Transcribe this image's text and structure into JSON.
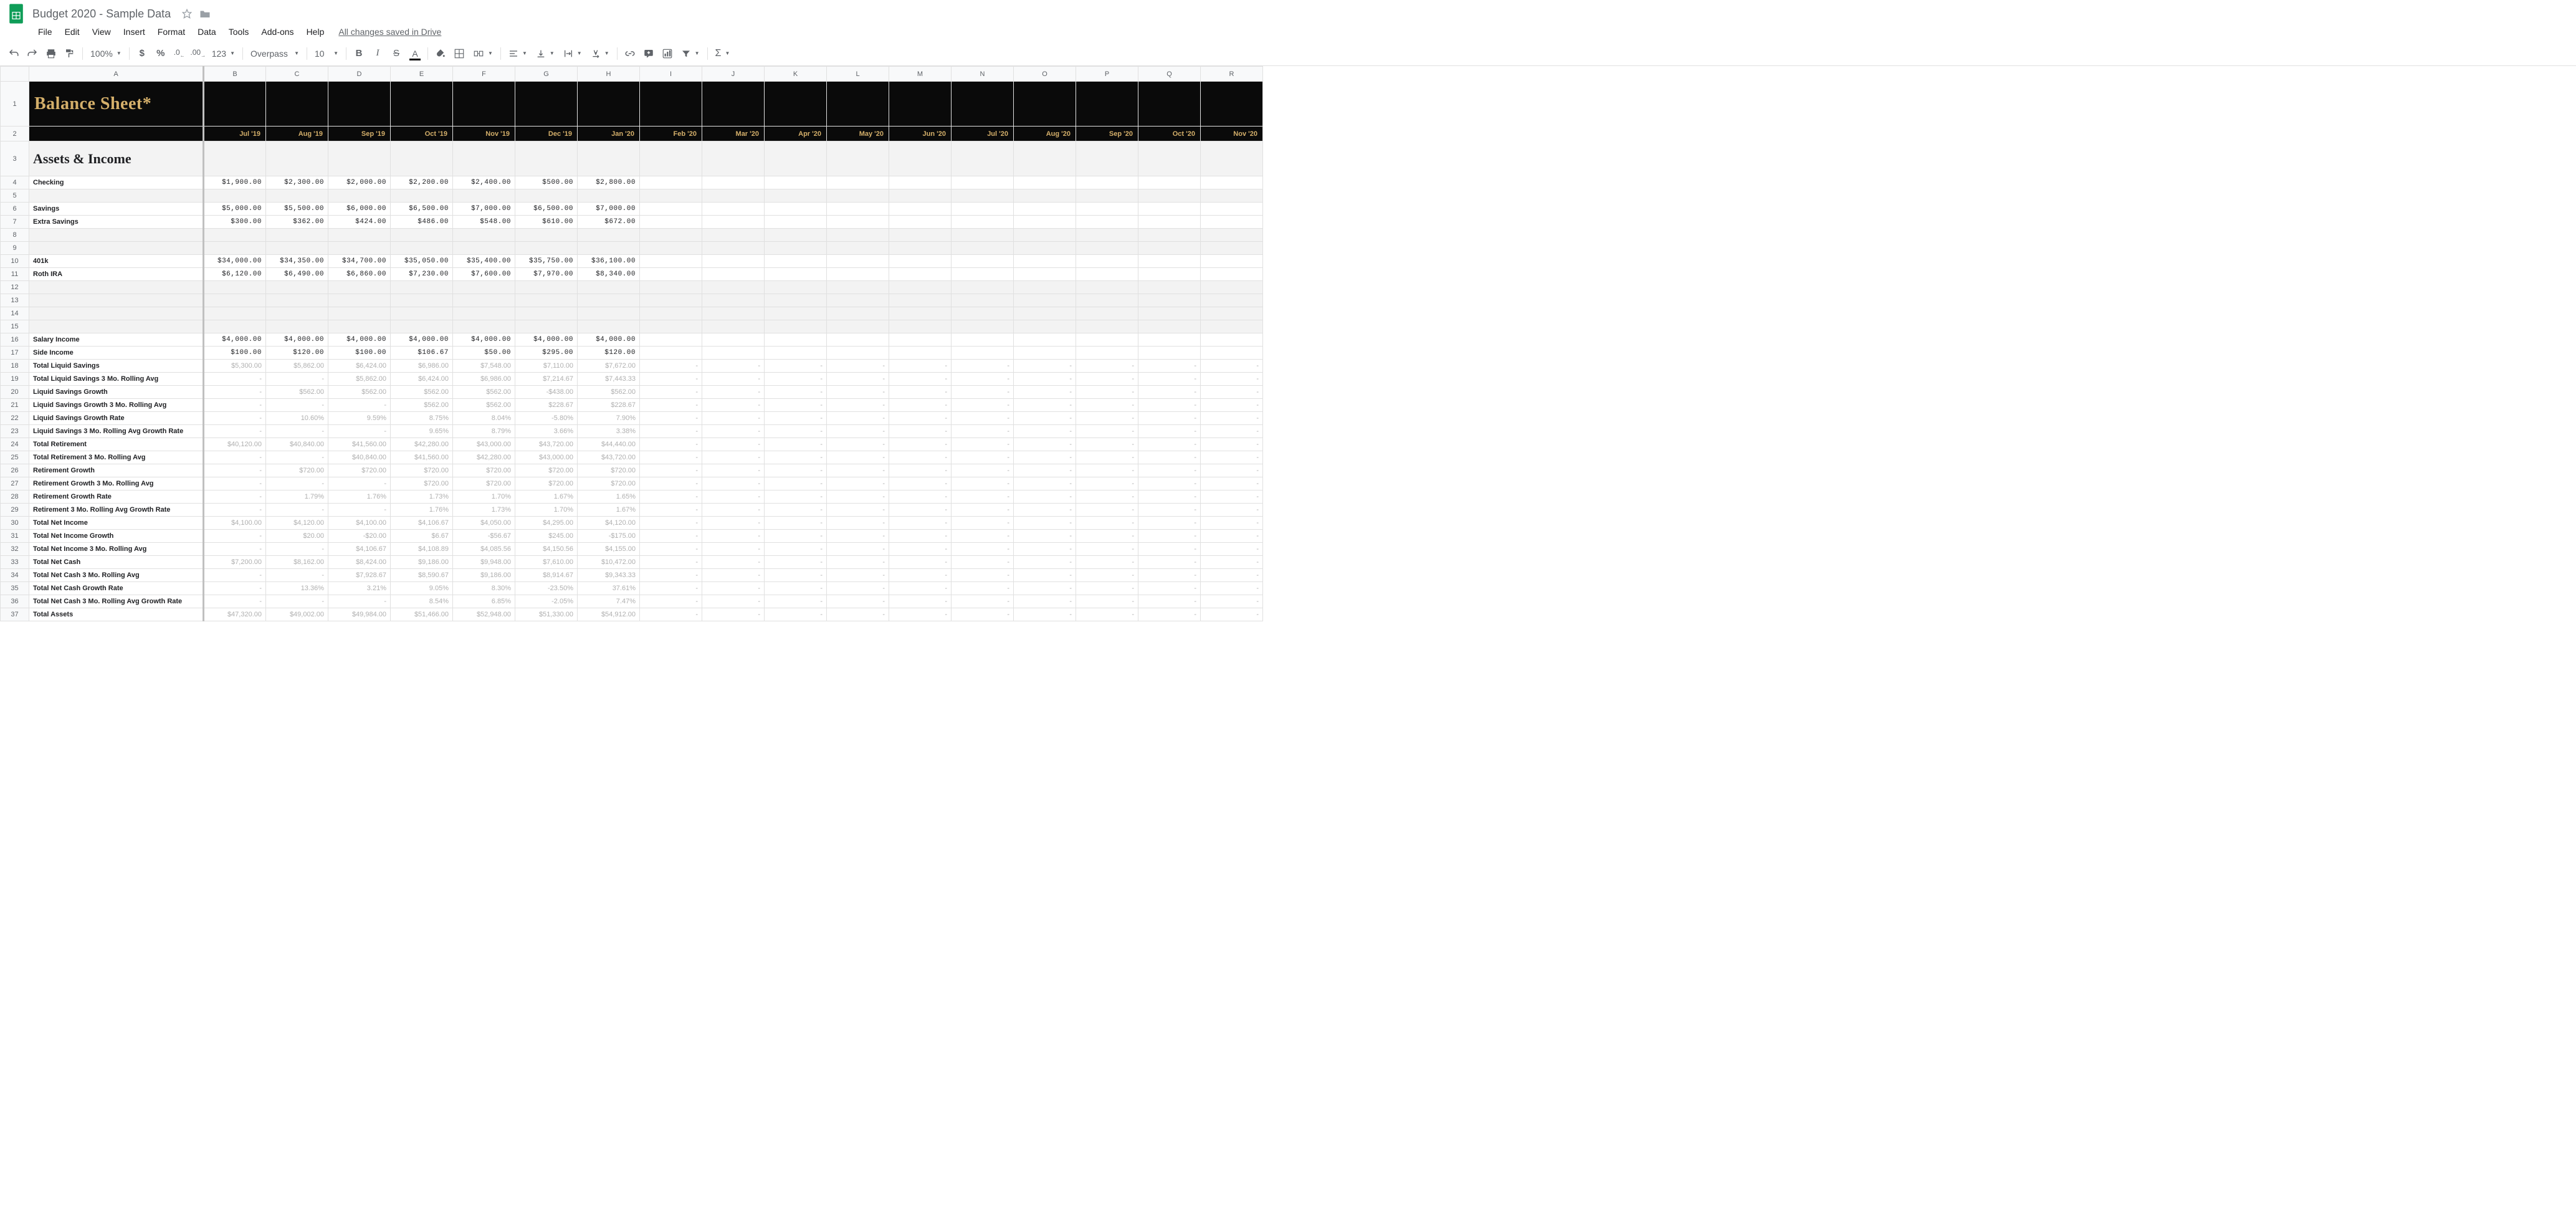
{
  "doc": {
    "title": "Budget 2020 - Sample Data"
  },
  "menu": {
    "items": [
      "File",
      "Edit",
      "View",
      "Insert",
      "Format",
      "Data",
      "Tools",
      "Add-ons",
      "Help"
    ],
    "status": "All changes saved in Drive"
  },
  "toolbar": {
    "zoom": "100%",
    "font": "Overpass",
    "size": "10"
  },
  "columns": [
    "A",
    "B",
    "C",
    "D",
    "E",
    "F",
    "G",
    "H",
    "I",
    "J",
    "K",
    "L",
    "M",
    "N",
    "O",
    "P",
    "Q",
    "R"
  ],
  "sheet": {
    "title": "Balance Sheet*",
    "months": [
      "Jul '19",
      "Aug '19",
      "Sep '19",
      "Oct '19",
      "Nov '19",
      "Dec '19",
      "Jan '20",
      "Feb '20",
      "Mar '20",
      "Apr '20",
      "May '20",
      "Jun '20",
      "Jul '20",
      "Aug '20",
      "Sep '20",
      "Oct '20",
      "Nov '20"
    ],
    "section": "Assets & Income",
    "rows": [
      {
        "n": 4,
        "label": "Checking",
        "type": "val",
        "vals": [
          "$1,900.00",
          "$2,300.00",
          "$2,000.00",
          "$2,200.00",
          "$2,400.00",
          "$500.00",
          "$2,800.00"
        ]
      },
      {
        "n": 5,
        "type": "blank"
      },
      {
        "n": 6,
        "label": "Savings",
        "type": "val",
        "vals": [
          "$5,000.00",
          "$5,500.00",
          "$6,000.00",
          "$6,500.00",
          "$7,000.00",
          "$6,500.00",
          "$7,000.00"
        ]
      },
      {
        "n": 7,
        "label": "Extra Savings",
        "type": "val",
        "vals": [
          "$300.00",
          "$362.00",
          "$424.00",
          "$486.00",
          "$548.00",
          "$610.00",
          "$672.00"
        ]
      },
      {
        "n": 8,
        "type": "blank"
      },
      {
        "n": 9,
        "type": "blank"
      },
      {
        "n": 10,
        "label": "401k",
        "type": "val",
        "vals": [
          "$34,000.00",
          "$34,350.00",
          "$34,700.00",
          "$35,050.00",
          "$35,400.00",
          "$35,750.00",
          "$36,100.00"
        ]
      },
      {
        "n": 11,
        "label": "Roth IRA",
        "type": "val",
        "vals": [
          "$6,120.00",
          "$6,490.00",
          "$6,860.00",
          "$7,230.00",
          "$7,600.00",
          "$7,970.00",
          "$8,340.00"
        ]
      },
      {
        "n": 12,
        "type": "blank"
      },
      {
        "n": 13,
        "type": "blank"
      },
      {
        "n": 14,
        "type": "blank"
      },
      {
        "n": 15,
        "type": "blank"
      },
      {
        "n": 16,
        "label": "Salary Income",
        "type": "val",
        "vals": [
          "$4,000.00",
          "$4,000.00",
          "$4,000.00",
          "$4,000.00",
          "$4,000.00",
          "$4,000.00",
          "$4,000.00"
        ]
      },
      {
        "n": 17,
        "label": "Side Income",
        "type": "val",
        "vals": [
          "$100.00",
          "$120.00",
          "$100.00",
          "$106.67",
          "$50.00",
          "$295.00",
          "$120.00"
        ]
      },
      {
        "n": 18,
        "label": "Total Liquid Savings",
        "type": "calc",
        "vals": [
          "$5,300.00",
          "$5,862.00",
          "$6,424.00",
          "$6,986.00",
          "$7,548.00",
          "$7,110.00",
          "$7,672.00"
        ],
        "dash": true
      },
      {
        "n": 19,
        "label": "Total Liquid Savings 3 Mo. Rolling Avg",
        "type": "calc",
        "vals": [
          "-",
          "-",
          "$5,862.00",
          "$6,424.00",
          "$6,986.00",
          "$7,214.67",
          "$7,443.33"
        ],
        "dash": true
      },
      {
        "n": 20,
        "label": "Liquid Savings Growth",
        "type": "calc",
        "vals": [
          "-",
          "$562.00",
          "$562.00",
          "$562.00",
          "$562.00",
          "-$438.00",
          "$562.00"
        ],
        "dash": true
      },
      {
        "n": 21,
        "label": "Liquid Savings Growth 3 Mo. Rolling Avg",
        "type": "calc",
        "vals": [
          "-",
          "-",
          "-",
          "$562.00",
          "$562.00",
          "$228.67",
          "$228.67"
        ],
        "dash": true
      },
      {
        "n": 22,
        "label": "Liquid Savings Growth Rate",
        "type": "calc",
        "vals": [
          "-",
          "10.60%",
          "9.59%",
          "8.75%",
          "8.04%",
          "-5.80%",
          "7.90%"
        ],
        "dash": true
      },
      {
        "n": 23,
        "label": "Liquid Savings 3 Mo. Rolling Avg Growth Rate",
        "type": "calc",
        "vals": [
          "-",
          "-",
          "-",
          "9.65%",
          "8.79%",
          "3.66%",
          "3.38%"
        ],
        "dash": true
      },
      {
        "n": 24,
        "label": "Total Retirement",
        "type": "calc",
        "vals": [
          "$40,120.00",
          "$40,840.00",
          "$41,560.00",
          "$42,280.00",
          "$43,000.00",
          "$43,720.00",
          "$44,440.00"
        ],
        "dash": true
      },
      {
        "n": 25,
        "label": "Total Retirement 3 Mo. Rolling Avg",
        "type": "calc",
        "vals": [
          "-",
          "-",
          "$40,840.00",
          "$41,560.00",
          "$42,280.00",
          "$43,000.00",
          "$43,720.00"
        ],
        "dash": true
      },
      {
        "n": 26,
        "label": "Retirement Growth",
        "type": "calc",
        "vals": [
          "-",
          "$720.00",
          "$720.00",
          "$720.00",
          "$720.00",
          "$720.00",
          "$720.00"
        ],
        "dash": true
      },
      {
        "n": 27,
        "label": "Retirement Growth 3 Mo. Rolling Avg",
        "type": "calc",
        "vals": [
          "-",
          "-",
          "-",
          "$720.00",
          "$720.00",
          "$720.00",
          "$720.00"
        ],
        "dash": true
      },
      {
        "n": 28,
        "label": "Retirement Growth Rate",
        "type": "calc",
        "vals": [
          "-",
          "1.79%",
          "1.76%",
          "1.73%",
          "1.70%",
          "1.67%",
          "1.65%"
        ],
        "dash": true
      },
      {
        "n": 29,
        "label": "Retirement 3 Mo. Rolling Avg Growth Rate",
        "type": "calc",
        "vals": [
          "-",
          "-",
          "-",
          "1.76%",
          "1.73%",
          "1.70%",
          "1.67%"
        ],
        "dash": true
      },
      {
        "n": 30,
        "label": "Total Net Income",
        "type": "calc",
        "vals": [
          "$4,100.00",
          "$4,120.00",
          "$4,100.00",
          "$4,106.67",
          "$4,050.00",
          "$4,295.00",
          "$4,120.00"
        ],
        "dash": true
      },
      {
        "n": 31,
        "label": "Total Net Income Growth",
        "type": "calc",
        "vals": [
          "-",
          "$20.00",
          "-$20.00",
          "$6.67",
          "-$56.67",
          "$245.00",
          "-$175.00"
        ],
        "dash": true
      },
      {
        "n": 32,
        "label": "Total Net Income 3 Mo. Rolling Avg",
        "type": "calc",
        "vals": [
          "-",
          "-",
          "$4,106.67",
          "$4,108.89",
          "$4,085.56",
          "$4,150.56",
          "$4,155.00"
        ],
        "dash": true
      },
      {
        "n": 33,
        "label": "Total Net Cash",
        "type": "calc",
        "vals": [
          "$7,200.00",
          "$8,162.00",
          "$8,424.00",
          "$9,186.00",
          "$9,948.00",
          "$7,610.00",
          "$10,472.00"
        ],
        "dash": true
      },
      {
        "n": 34,
        "label": "Total Net Cash 3 Mo. Rolling Avg",
        "type": "calc",
        "vals": [
          "-",
          "-",
          "$7,928.67",
          "$8,590.67",
          "$9,186.00",
          "$8,914.67",
          "$9,343.33"
        ],
        "dash": true
      },
      {
        "n": 35,
        "label": "Total Net Cash Growth Rate",
        "type": "calc",
        "vals": [
          "-",
          "13.36%",
          "3.21%",
          "9.05%",
          "8.30%",
          "-23.50%",
          "37.61%"
        ],
        "dash": true
      },
      {
        "n": 36,
        "label": "Total Net Cash 3 Mo. Rolling Avg Growth Rate",
        "type": "calc",
        "vals": [
          "-",
          "-",
          "-",
          "8.54%",
          "6.85%",
          "-2.05%",
          "7.47%"
        ],
        "dash": true
      },
      {
        "n": 37,
        "label": "Total Assets",
        "type": "calc",
        "vals": [
          "$47,320.00",
          "$49,002.00",
          "$49,984.00",
          "$51,466.00",
          "$52,948.00",
          "$51,330.00",
          "$54,912.00"
        ],
        "dash": true
      }
    ]
  }
}
